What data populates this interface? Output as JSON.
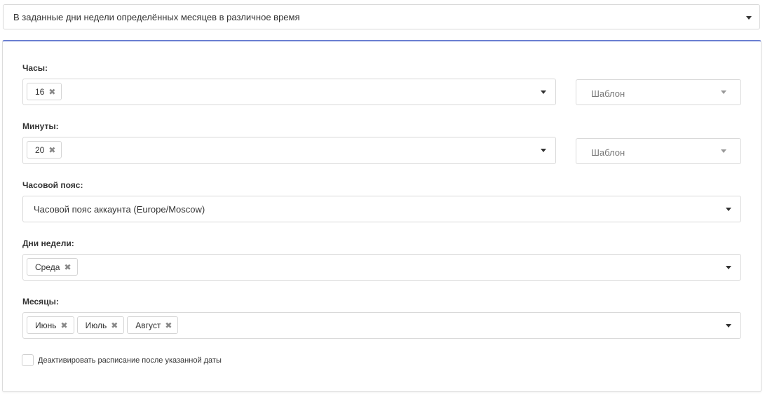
{
  "schedule_type": {
    "selected": "В заданные дни недели определённых месяцев в различное время"
  },
  "hours": {
    "label": "Часы:",
    "tags": [
      "16"
    ],
    "template_placeholder": "Шаблон"
  },
  "minutes": {
    "label": "Минуты:",
    "tags": [
      "20"
    ],
    "template_placeholder": "Шаблон"
  },
  "timezone": {
    "label": "Часовой пояс:",
    "selected": "Часовой пояс аккаунта (Europe/Moscow)"
  },
  "weekdays": {
    "label": "Дни недели:",
    "tags": [
      "Среда"
    ]
  },
  "months": {
    "label": "Месяцы:",
    "tags": [
      "Июнь",
      "Июль",
      "Август"
    ]
  },
  "deactivate": {
    "label": "Деактивировать расписание после указанной даты",
    "checked": false
  },
  "icons": {
    "tag_remove": "✖",
    "dropdown": "caret-down-icon"
  },
  "colors": {
    "panel_accent": "#6a7fd1",
    "border": "#d9d9d9"
  }
}
